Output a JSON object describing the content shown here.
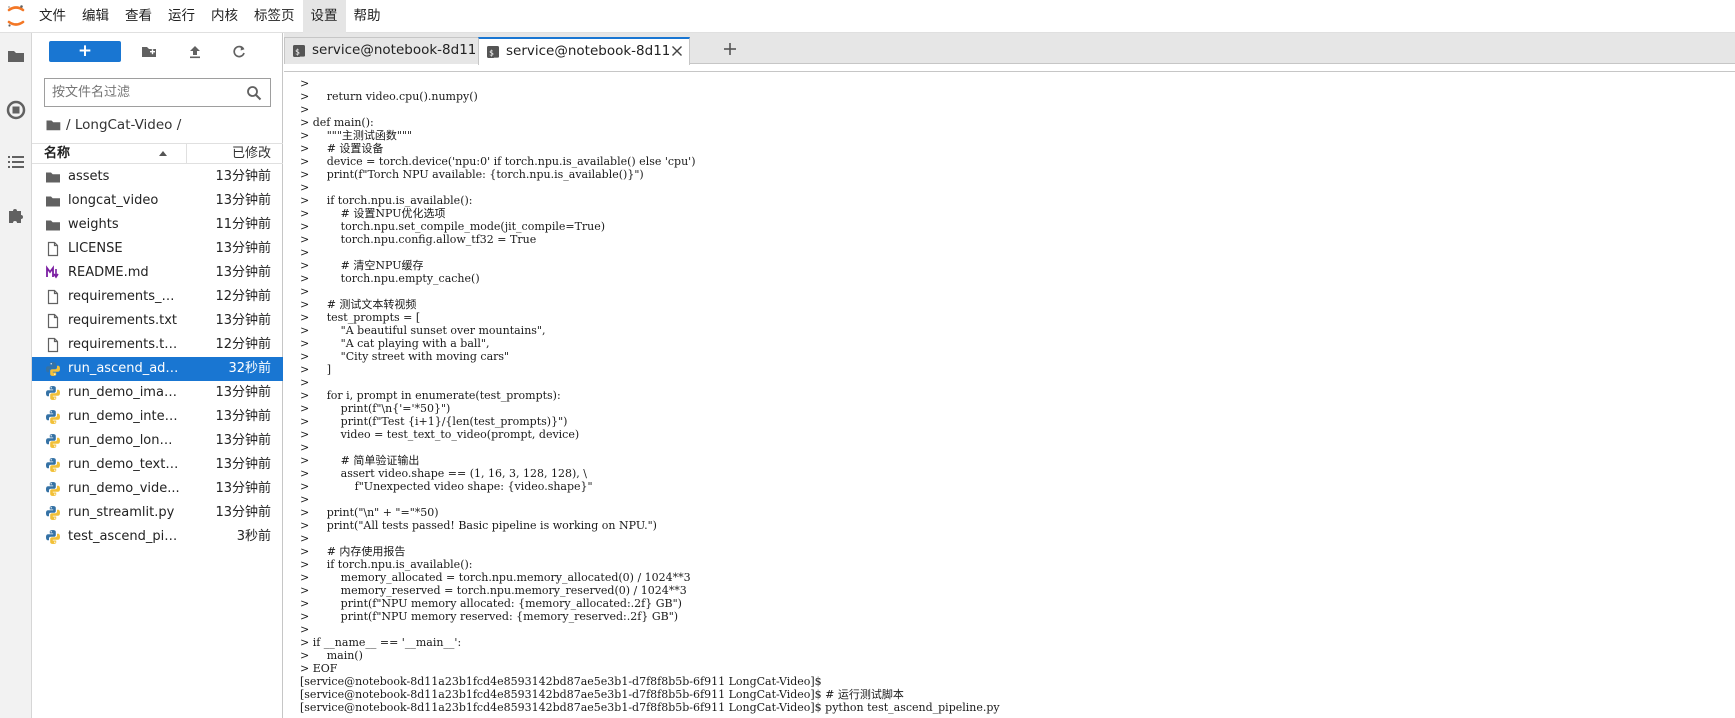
{
  "menu": {
    "items": [
      "文件",
      "编辑",
      "查看",
      "运行",
      "内核",
      "标签页",
      "设置",
      "帮助"
    ],
    "active_index": 6
  },
  "activity_bar": {
    "icons": [
      "folder-icon",
      "running-stop-icon",
      "table-of-contents-icon",
      "extension-puzzle-icon"
    ]
  },
  "file_browser": {
    "new_button_label": "+",
    "filter_placeholder": "按文件名过滤",
    "breadcrumb": "/ LongCat-Video /",
    "header": {
      "name": "名称",
      "modified": "已修改"
    },
    "items": [
      {
        "name": "assets",
        "type": "folder",
        "modified": "13分钟前",
        "selected": false
      },
      {
        "name": "longcat_video",
        "type": "folder",
        "modified": "13分钟前",
        "selected": false
      },
      {
        "name": "weights",
        "type": "folder",
        "modified": "11分钟前",
        "selected": false
      },
      {
        "name": "LICENSE",
        "type": "file",
        "modified": "13分钟前",
        "selected": false
      },
      {
        "name": "README.md",
        "type": "markdown",
        "modified": "13分钟前",
        "selected": false
      },
      {
        "name": "requirements_as...",
        "type": "file",
        "modified": "12分钟前",
        "selected": false
      },
      {
        "name": "requirements.txt",
        "type": "file",
        "modified": "13分钟前",
        "selected": false
      },
      {
        "name": "requirements.tx...",
        "type": "file",
        "modified": "12分钟前",
        "selected": false
      },
      {
        "name": "run_ascend_ada...",
        "type": "python",
        "modified": "32秒前",
        "selected": true
      },
      {
        "name": "run_demo_imag...",
        "type": "python",
        "modified": "13分钟前",
        "selected": false
      },
      {
        "name": "run_demo_inter...",
        "type": "python",
        "modified": "13分钟前",
        "selected": false
      },
      {
        "name": "run_demo_long...",
        "type": "python",
        "modified": "13分钟前",
        "selected": false
      },
      {
        "name": "run_demo_text_...",
        "type": "python",
        "modified": "13分钟前",
        "selected": false
      },
      {
        "name": "run_demo_vide...",
        "type": "python",
        "modified": "13分钟前",
        "selected": false
      },
      {
        "name": "run_streamlit.py",
        "type": "python",
        "modified": "13分钟前",
        "selected": false
      },
      {
        "name": "test_ascend_pip...",
        "type": "python",
        "modified": "3秒前",
        "selected": false
      }
    ]
  },
  "tabs": [
    {
      "label": "service@notebook-8d11a",
      "active": false
    },
    {
      "label": "service@notebook-8d11a",
      "active": true
    }
  ],
  "add_tab_label": "+",
  "terminal": {
    "lines": [
      ">",
      ">     return video.cpu().numpy()",
      ">",
      "> def main():",
      ">     \"\"\"主测试函数\"\"\"",
      ">     # 设置设备",
      ">     device = torch.device('npu:0' if torch.npu.is_available() else 'cpu')",
      ">     print(f\"Torch NPU available: {torch.npu.is_available()}\")",
      ">",
      ">     if torch.npu.is_available():",
      ">         # 设置NPU优化选项",
      ">         torch.npu.set_compile_mode(jit_compile=True)",
      ">         torch.npu.config.allow_tf32 = True",
      ">",
      ">         # 清空NPU缓存",
      ">         torch.npu.empty_cache()",
      ">",
      ">     # 测试文本转视频",
      ">     test_prompts = [",
      ">         \"A beautiful sunset over mountains\",",
      ">         \"A cat playing with a ball\",",
      ">         \"City street with moving cars\"",
      ">     ]",
      ">",
      ">     for i, prompt in enumerate(test_prompts):",
      ">         print(f\"\\n{'='*50}\")",
      ">         print(f\"Test {i+1}/{len(test_prompts)}\")",
      ">         video = test_text_to_video(prompt, device)",
      ">",
      ">         # 简单验证输出",
      ">         assert video.shape == (1, 16, 3, 128, 128), \\",
      ">             f\"Unexpected video shape: {video.shape}\"",
      ">",
      ">     print(\"\\n\" + \"=\"*50)",
      ">     print(\"All tests passed! Basic pipeline is working on NPU.\")",
      ">",
      ">     # 内存使用报告",
      ">     if torch.npu.is_available():",
      ">         memory_allocated = torch.npu.memory_allocated(0) / 1024**3",
      ">         memory_reserved = torch.npu.memory_reserved(0) / 1024**3",
      ">         print(f\"NPU memory allocated: {memory_allocated:.2f} GB\")",
      ">         print(f\"NPU memory reserved: {memory_reserved:.2f} GB\")",
      ">",
      "> if __name__ == '__main__':",
      ">     main()",
      "> EOF",
      "[service@notebook-8d11a23b1fcd4e8593142bd87ae5e3b1-d7f8f8b5b-6f911 LongCat-Video]$",
      "[service@notebook-8d11a23b1fcd4e8593142bd87ae5e3b1-d7f8f8b5b-6f911 LongCat-Video]$ # 运行测试脚本",
      "[service@notebook-8d11a23b1fcd4e8593142bd87ae5e3b1-d7f8f8b5b-6f911 LongCat-Video]$ python test_ascend_pipeline.py"
    ]
  },
  "colors": {
    "accent": "#1976d2",
    "python_blue": "#3572a5",
    "python_yellow": "#f2c037",
    "markdown_purple": "#7b1fa2",
    "logo_orange": "#f37726"
  }
}
